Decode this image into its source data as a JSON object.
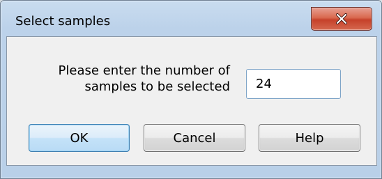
{
  "window": {
    "title": "Select samples"
  },
  "dialog": {
    "prompt_line1": "Please enter the number of",
    "prompt_line2": "samples to be selected",
    "sample_count_value": "24"
  },
  "buttons": {
    "ok_label": "OK",
    "cancel_label": "Cancel",
    "help_label": "Help"
  },
  "icons": {
    "close": "close-icon"
  },
  "colors": {
    "close_button": "#c6412a",
    "default_button_border": "#3c7fb1",
    "dialog_background": "#f0f0f0"
  }
}
